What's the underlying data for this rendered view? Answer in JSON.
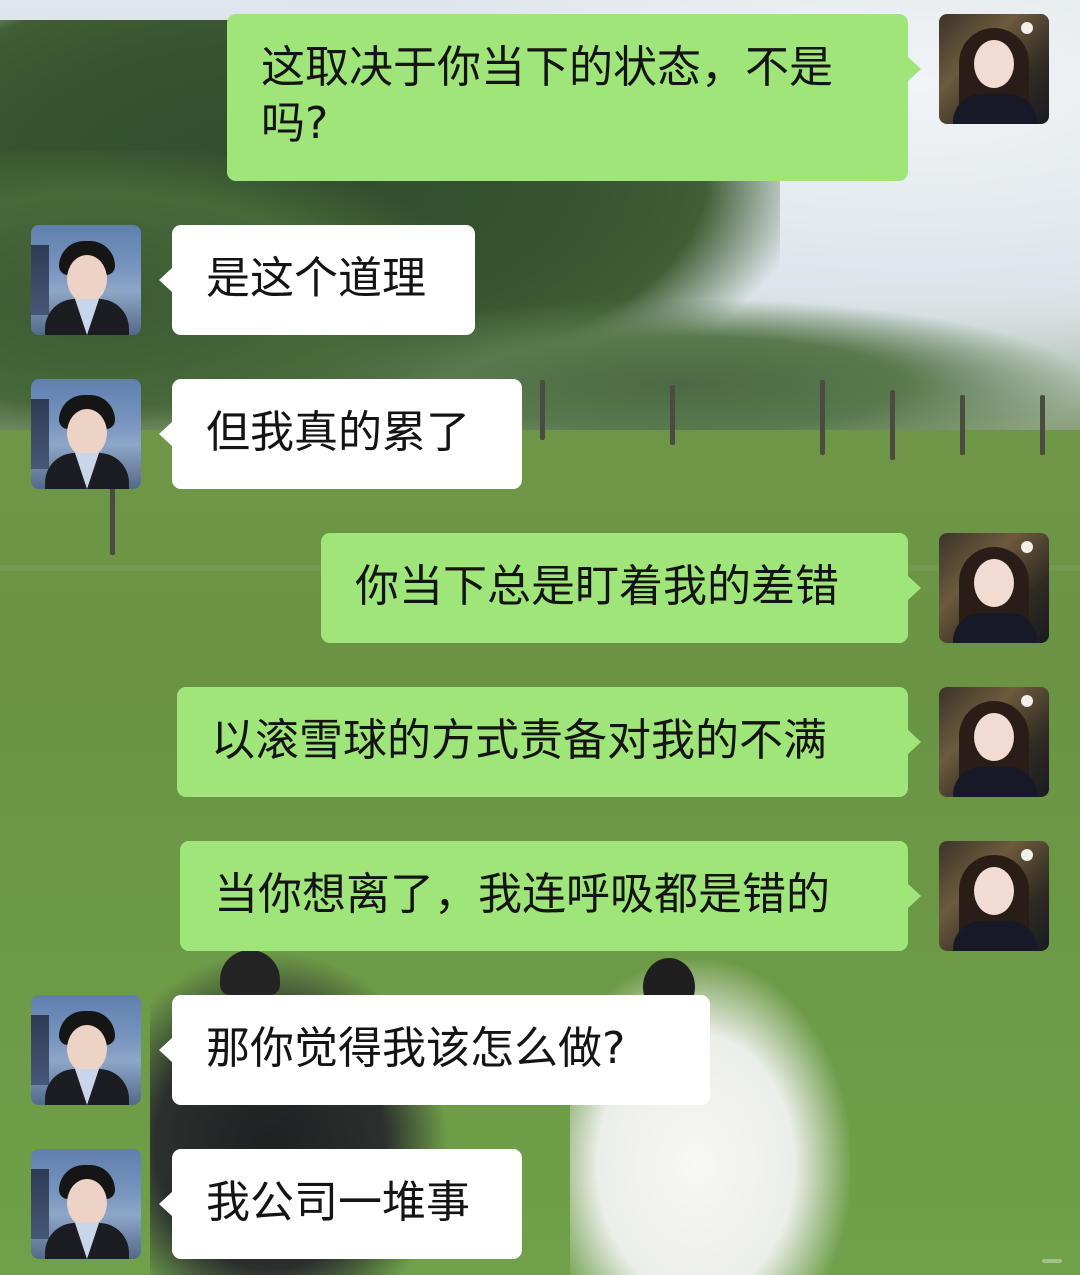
{
  "chat": {
    "messages": [
      {
        "side": "right",
        "text": "这取决于你当下的状态，不是吗?"
      },
      {
        "side": "left",
        "text": "是这个道理"
      },
      {
        "side": "left",
        "text": "但我真的累了"
      },
      {
        "side": "right",
        "text": "你当下总是盯着我的差错"
      },
      {
        "side": "right",
        "text": "以滚雪球的方式责备对我的不满"
      },
      {
        "side": "right",
        "text": "当你想离了，我连呼吸都是错的"
      },
      {
        "side": "left",
        "text": "那你觉得我该怎么做?"
      },
      {
        "side": "left",
        "text": "我公司一堆事"
      }
    ]
  },
  "colors": {
    "sent_bubble": "#a0e57a",
    "received_bubble": "#ffffff"
  },
  "icons": {
    "sender_avatar": "avatar-girl-portrait",
    "receiver_avatar": "avatar-boy-portrait"
  }
}
